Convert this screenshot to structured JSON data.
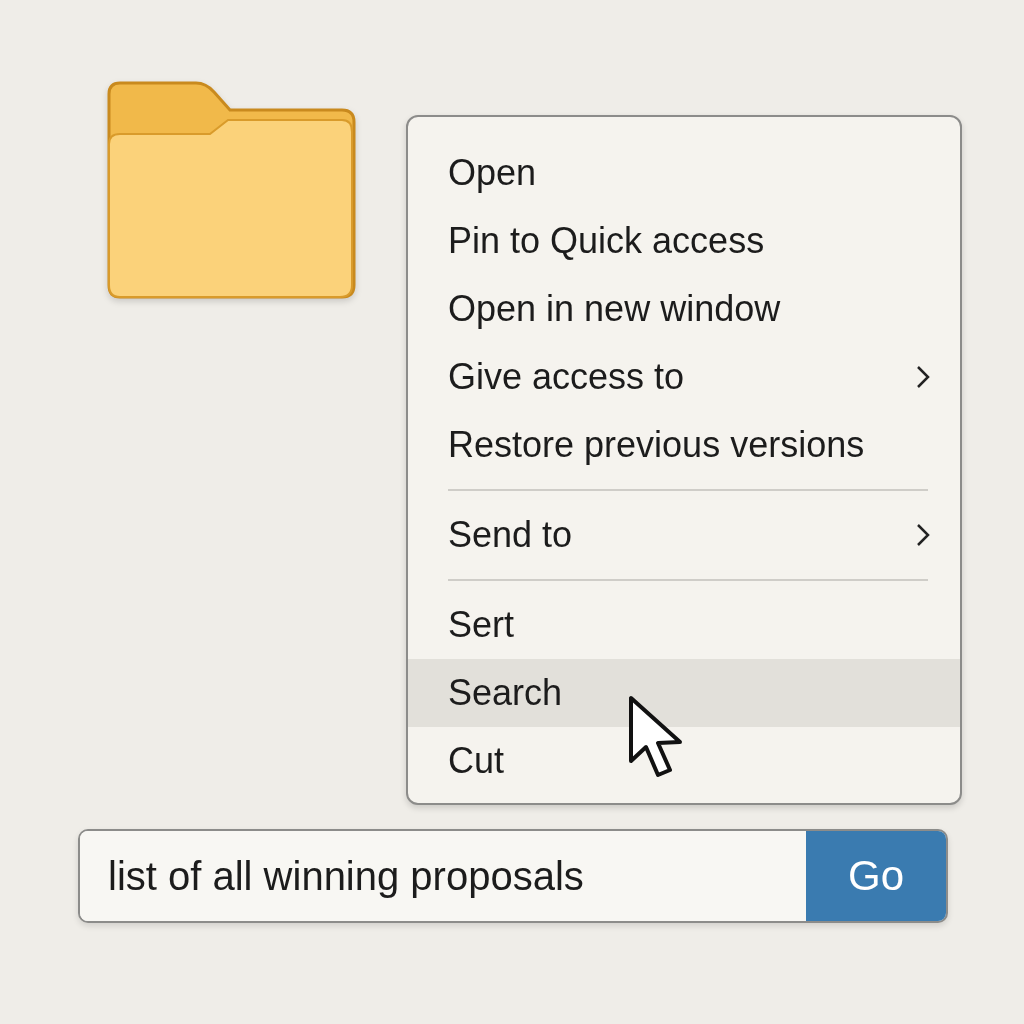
{
  "context_menu": {
    "items": [
      {
        "kind": "item",
        "label": "Open",
        "submenu": false,
        "selected": false
      },
      {
        "kind": "item",
        "label": "Pin to Quick access",
        "submenu": false,
        "selected": false
      },
      {
        "kind": "item",
        "label": "Open in new window",
        "submenu": false,
        "selected": false
      },
      {
        "kind": "item",
        "label": "Give access to",
        "submenu": true,
        "selected": false
      },
      {
        "kind": "item",
        "label": "Restore previous versions",
        "submenu": false,
        "selected": false
      },
      {
        "kind": "separator"
      },
      {
        "kind": "item",
        "label": "Send to",
        "submenu": true,
        "selected": false
      },
      {
        "kind": "separator"
      },
      {
        "kind": "item",
        "label": "Sert",
        "submenu": false,
        "selected": false
      },
      {
        "kind": "item",
        "label": "Search",
        "submenu": false,
        "selected": true
      },
      {
        "kind": "item",
        "label": "Cut",
        "submenu": false,
        "selected": false
      }
    ]
  },
  "search_bar": {
    "value": "list of all winning proposals",
    "button": "Go"
  }
}
